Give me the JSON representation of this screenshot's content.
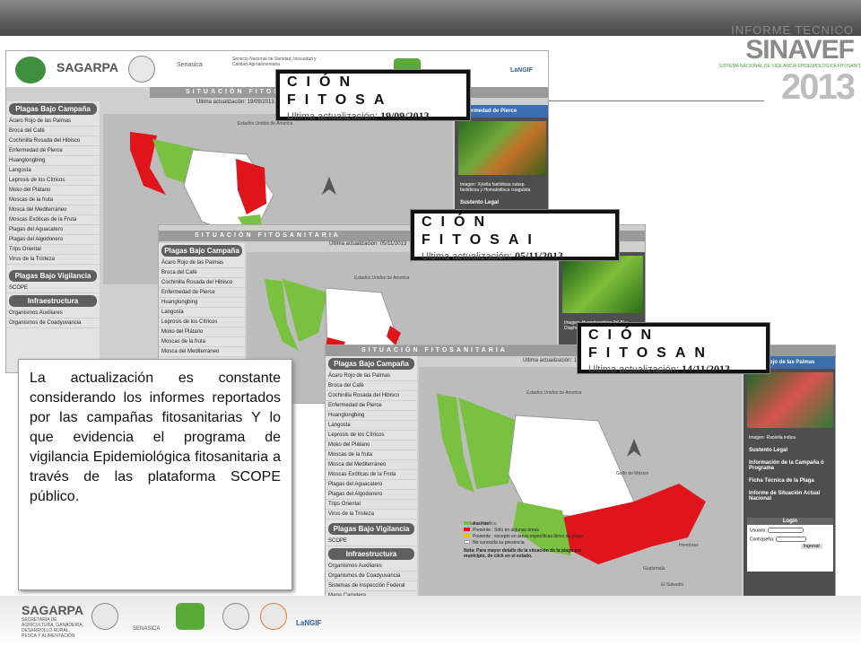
{
  "report": {
    "line1": "INFORME TECNICO",
    "line2": "SINAVEF",
    "line3": "SISTEMA NACIONAL DE VIGILANCIA EPIDEMIOLÓGICA FITOSANITARIA",
    "year": "2013"
  },
  "screens": [
    {
      "section_title": "SITUACIÓN FITOSANITARIA",
      "update_label": "Ultima actualización:",
      "update_date": "19/09/2013",
      "zoom_big": "CIÓN FITOSA",
      "right_title": "Enfermedad de Pierce",
      "caption": "Imagen: Xylella fastidiosa subsp. fastidiosa y Homalodisca coagulata"
    },
    {
      "section_title": "SITUACIÓN FITOSANITARIA",
      "update_label": "Ultima actualización:",
      "update_date": "05/11/2013",
      "zoom_big": "CIÓN FITOSAI",
      "caption": "Imagen: Huanglongbing (HLB) y Diaphorina citri"
    },
    {
      "section_title": "SITUACIÓN FITOSANITARIA",
      "update_label": "Ultima actualización:",
      "update_date": "14/11/2013",
      "zoom_big": "CIÓN FITOSAN",
      "right_title": "Ácaro Rojo de las Palmas",
      "caption": "Imagen: Raoiella indica"
    }
  ],
  "sidebar": {
    "campaign_title": "Plagas Bajo Campaña",
    "campaign_items": [
      "Ácaro Rojo de las Palmas",
      "Broca del Café",
      "Cochinilla Rosada del Hibisco",
      "Enfermedad de Pierce",
      "Huanglongbing",
      "Langosta",
      "Leprosis de los Cítricos",
      "Moko del Plátano",
      "Moscas de la fruta",
      "Mosca del Mediterráneo",
      "Moscas Exóticas de la Fruta",
      "Plagas del Aguacatero",
      "Plagas del Algodonero",
      "Trips Oriental",
      "Virus de la Tristeza"
    ],
    "vig_title": "Plagas Bajo Vigilancia",
    "vig_item": "SCOPE",
    "infra_title": "Infraestructura",
    "infra_items": [
      "Organismos Auxiliares",
      "Organismos de Coadyuvancia",
      "Sistemas de Inspección Federal",
      "Mapa Carretera"
    ]
  },
  "right_links": [
    "Sustento Legal",
    "Información de la Campaña ó Programa",
    "Ficha Técnica de la Plaga",
    "Informe de Situación Actual Nacional"
  ],
  "login": {
    "title": "Login",
    "user": "Usuario:",
    "pass": "Contraseña:",
    "button": "Ingresar"
  },
  "legend": [
    "Ausente",
    "Presente : Sólo en algunas áreas",
    "Presente : excepto en áreas específicas libres de plaga",
    "No conocida su presencia"
  ],
  "legend_colors": [
    "#7ac142",
    "#e0141b",
    "#e8c01a",
    "#ffffff"
  ],
  "note": "Nota: Para mayor detalle de la situación de la plaga por municipio, de click en el estado.",
  "map_labels": {
    "usa": "Estados Unidos de America",
    "gulf": "Golfo de México",
    "pacific": "Océano Pacífico",
    "guatemala": "Guatemala",
    "honduras": "Honduras",
    "salvador": "El Salvador",
    "belice": "Belice"
  },
  "header": {
    "sagarpa": "SAGARPA",
    "senasica": "Senasica",
    "senasica_text": "Servicio Nacional de Sanidad, Inocuidad y Calidad Agroalimentaria",
    "langif": "LaNGIF"
  },
  "text_box": "La actualización es constante considerando los informes reportados por las campañas fitosanitarias Y lo que evidencia el programa de vigilancia Epidemiológica fitosanitaria a través de las plataforma SCOPE público.",
  "footer": {
    "sagarpa": "SAGARPA",
    "sagarpa_sub": "SECRETARÍA DE AGRICULTURA, GANADERÍA, DESARROLLO RURAL, PESCA Y ALIMENTACIÓN",
    "senasica": "SENASICA",
    "langif": "LaNGIF"
  }
}
